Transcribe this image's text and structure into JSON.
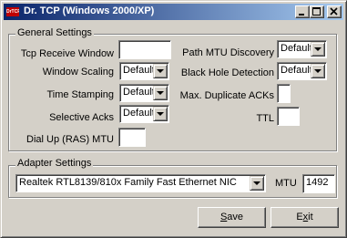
{
  "window": {
    "title": "Dr. TCP (Windows 2000/XP)",
    "icon_text": "DrTCP",
    "title_gradient": [
      "#0a246a",
      "#a6caf0"
    ],
    "face_color": "#d4d0c8"
  },
  "titlebar_buttons": [
    {
      "name": "minimize",
      "icon": "minimize-icon"
    },
    {
      "name": "maximize",
      "icon": "maximize-icon"
    },
    {
      "name": "close",
      "icon": "close-icon"
    }
  ],
  "general": {
    "title": "General Settings",
    "tcp_receive_window": {
      "label": "Tcp Receive Window",
      "value": ""
    },
    "window_scaling": {
      "label": "Window Scaling",
      "value": "Default"
    },
    "time_stamping": {
      "label": "Time Stamping",
      "value": "Default"
    },
    "selective_acks": {
      "label": "Selective Acks",
      "value": "Default"
    },
    "dialup_mtu": {
      "label": "Dial Up (RAS) MTU",
      "value": ""
    },
    "path_mtu_discovery": {
      "label": "Path MTU Discovery",
      "value": "Default"
    },
    "black_hole_detection": {
      "label": "Black Hole Detection",
      "value": "Default"
    },
    "max_duplicate_acks": {
      "label": "Max. Duplicate ACKs",
      "value": ""
    },
    "ttl": {
      "label": "TTL",
      "value": ""
    }
  },
  "adapter": {
    "title": "Adapter Settings",
    "nic": "Realtek RTL8139/810x Family Fast Ethernet NIC",
    "mtu_label": "MTU",
    "mtu_value": "1492"
  },
  "buttons": {
    "save": {
      "mnemonic": "S",
      "rest": "ave"
    },
    "exit": {
      "pre": "E",
      "mnemonic": "x",
      "rest": "it"
    }
  }
}
